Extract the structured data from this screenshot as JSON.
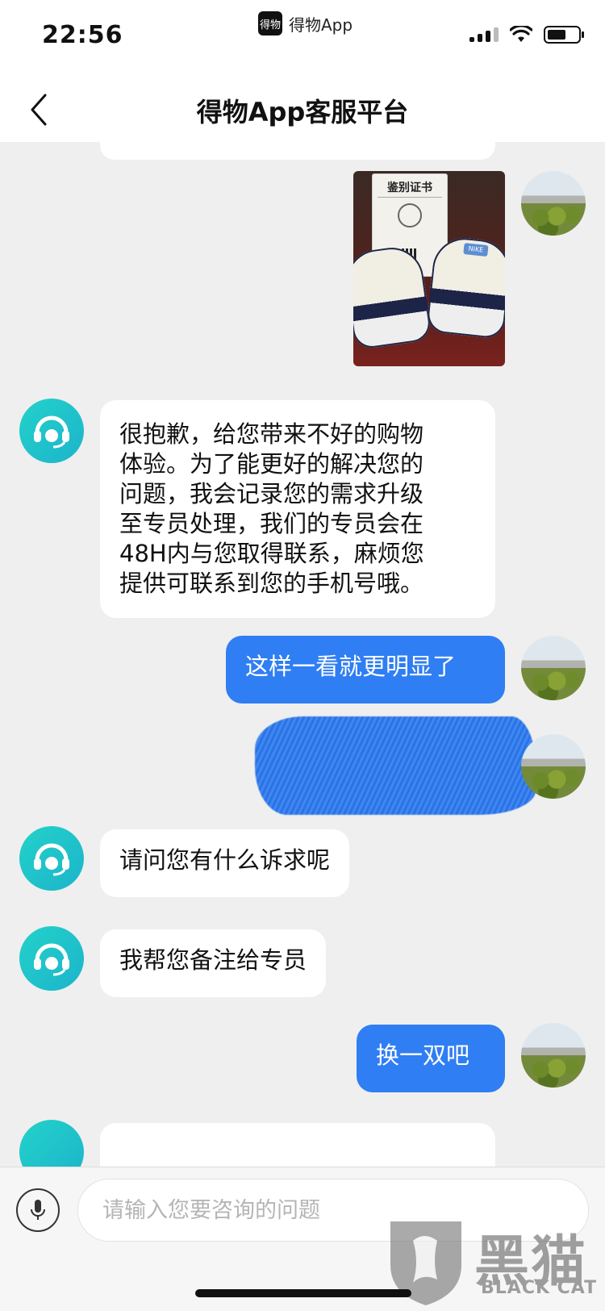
{
  "status_bar": {
    "time": "22:56",
    "app_pill_label": "得物App",
    "app_logo_text": "得物"
  },
  "nav": {
    "title": "得物App客服平台",
    "back_icon": "chevron-left-icon"
  },
  "photo": {
    "certificate_title": "鉴别证书",
    "brand_text": "NIKE"
  },
  "messages": [
    {
      "side": "left",
      "text": "很抱歉，给您带来不好的购物\n体验。为了能更好的解决您的\n问题，我会记录您的需求升级\n至专员处理，我们的专员会在\n48H内与您取得联系，麻烦您\n提供可联系到您的手机号哦。"
    },
    {
      "side": "right",
      "text": "这样一看就更明显了"
    },
    {
      "side": "left",
      "text": "请问您有什么诉求呢"
    },
    {
      "side": "left",
      "text": "我帮您备注给专员"
    },
    {
      "side": "right",
      "text": "换一双吧"
    }
  ],
  "input_bar": {
    "placeholder": "请输入您要咨询的问题",
    "mic_icon": "microphone-icon"
  },
  "watermark": {
    "chinese": "黑猫",
    "english": "BLACK CAT"
  },
  "colors": {
    "user_bubble": "#2f7ef3",
    "agent_avatar": "#1fc4ca",
    "background": "#efefef"
  }
}
